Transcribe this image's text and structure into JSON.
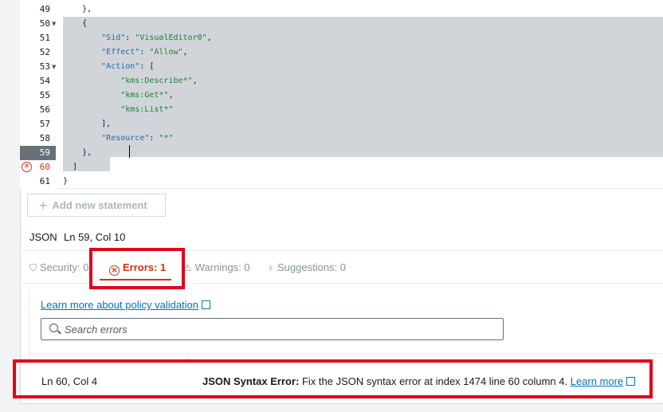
{
  "editor": {
    "lines": [
      {
        "num": "49",
        "code_parts": [
          [
            "",
            "    },"
          ]
        ]
      },
      {
        "num": "50",
        "code_parts": [
          [
            "",
            "    {"
          ]
        ],
        "fold": true
      },
      {
        "num": "51",
        "code_parts": [
          [
            "key",
            "        \"Sid\""
          ],
          [
            "",
            ": "
          ],
          [
            "str",
            "\"VisualEditor0\""
          ],
          [
            "",
            ","
          ]
        ]
      },
      {
        "num": "52",
        "code_parts": [
          [
            "key",
            "        \"Effect\""
          ],
          [
            "",
            ": "
          ],
          [
            "str",
            "\"Allow\""
          ],
          [
            "",
            ","
          ]
        ]
      },
      {
        "num": "53",
        "code_parts": [
          [
            "key",
            "        \"Action\""
          ],
          [
            "",
            ": ["
          ]
        ],
        "fold": true
      },
      {
        "num": "54",
        "code_parts": [
          [
            "str",
            "            \"kms:Describe*\""
          ],
          [
            "",
            ","
          ]
        ]
      },
      {
        "num": "55",
        "code_parts": [
          [
            "str",
            "            \"kms:Get*\""
          ],
          [
            "",
            ","
          ]
        ]
      },
      {
        "num": "56",
        "code_parts": [
          [
            "str",
            "            \"kms:List*\""
          ]
        ]
      },
      {
        "num": "57",
        "code_parts": [
          [
            "",
            "        ],"
          ]
        ]
      },
      {
        "num": "58",
        "code_parts": [
          [
            "key",
            "        \"Resource\""
          ],
          [
            "",
            ": "
          ],
          [
            "str",
            "\"*\""
          ]
        ]
      },
      {
        "num": "59",
        "code_parts": [
          [
            "",
            "    },"
          ]
        ],
        "active": true
      },
      {
        "num": "60",
        "code_parts": [
          [
            "",
            "  ]"
          ]
        ],
        "error": true
      },
      {
        "num": "61",
        "code_parts": [
          [
            "",
            "}"
          ]
        ]
      }
    ]
  },
  "add_statement_label": "Add new statement",
  "status": {
    "language": "JSON",
    "position": "Ln 59, Col 10"
  },
  "tabs": {
    "security": "Security: 0",
    "errors": "Errors: 1",
    "warnings": "Warnings: 0",
    "suggestions": "Suggestions: 0"
  },
  "errors_panel": {
    "learn_more_link": "Learn more about policy validation",
    "search_placeholder": "Search errors",
    "rows": [
      {
        "location": "Ln 60, Col 4",
        "title": "JSON Syntax Error:",
        "message": " Fix the JSON syntax error at index 1474 line 60 column 4. ",
        "link": "Learn more"
      }
    ]
  },
  "colors": {
    "error_red": "#d13212",
    "link_blue": "#0073bb",
    "highlight_box": "#e2001a"
  }
}
